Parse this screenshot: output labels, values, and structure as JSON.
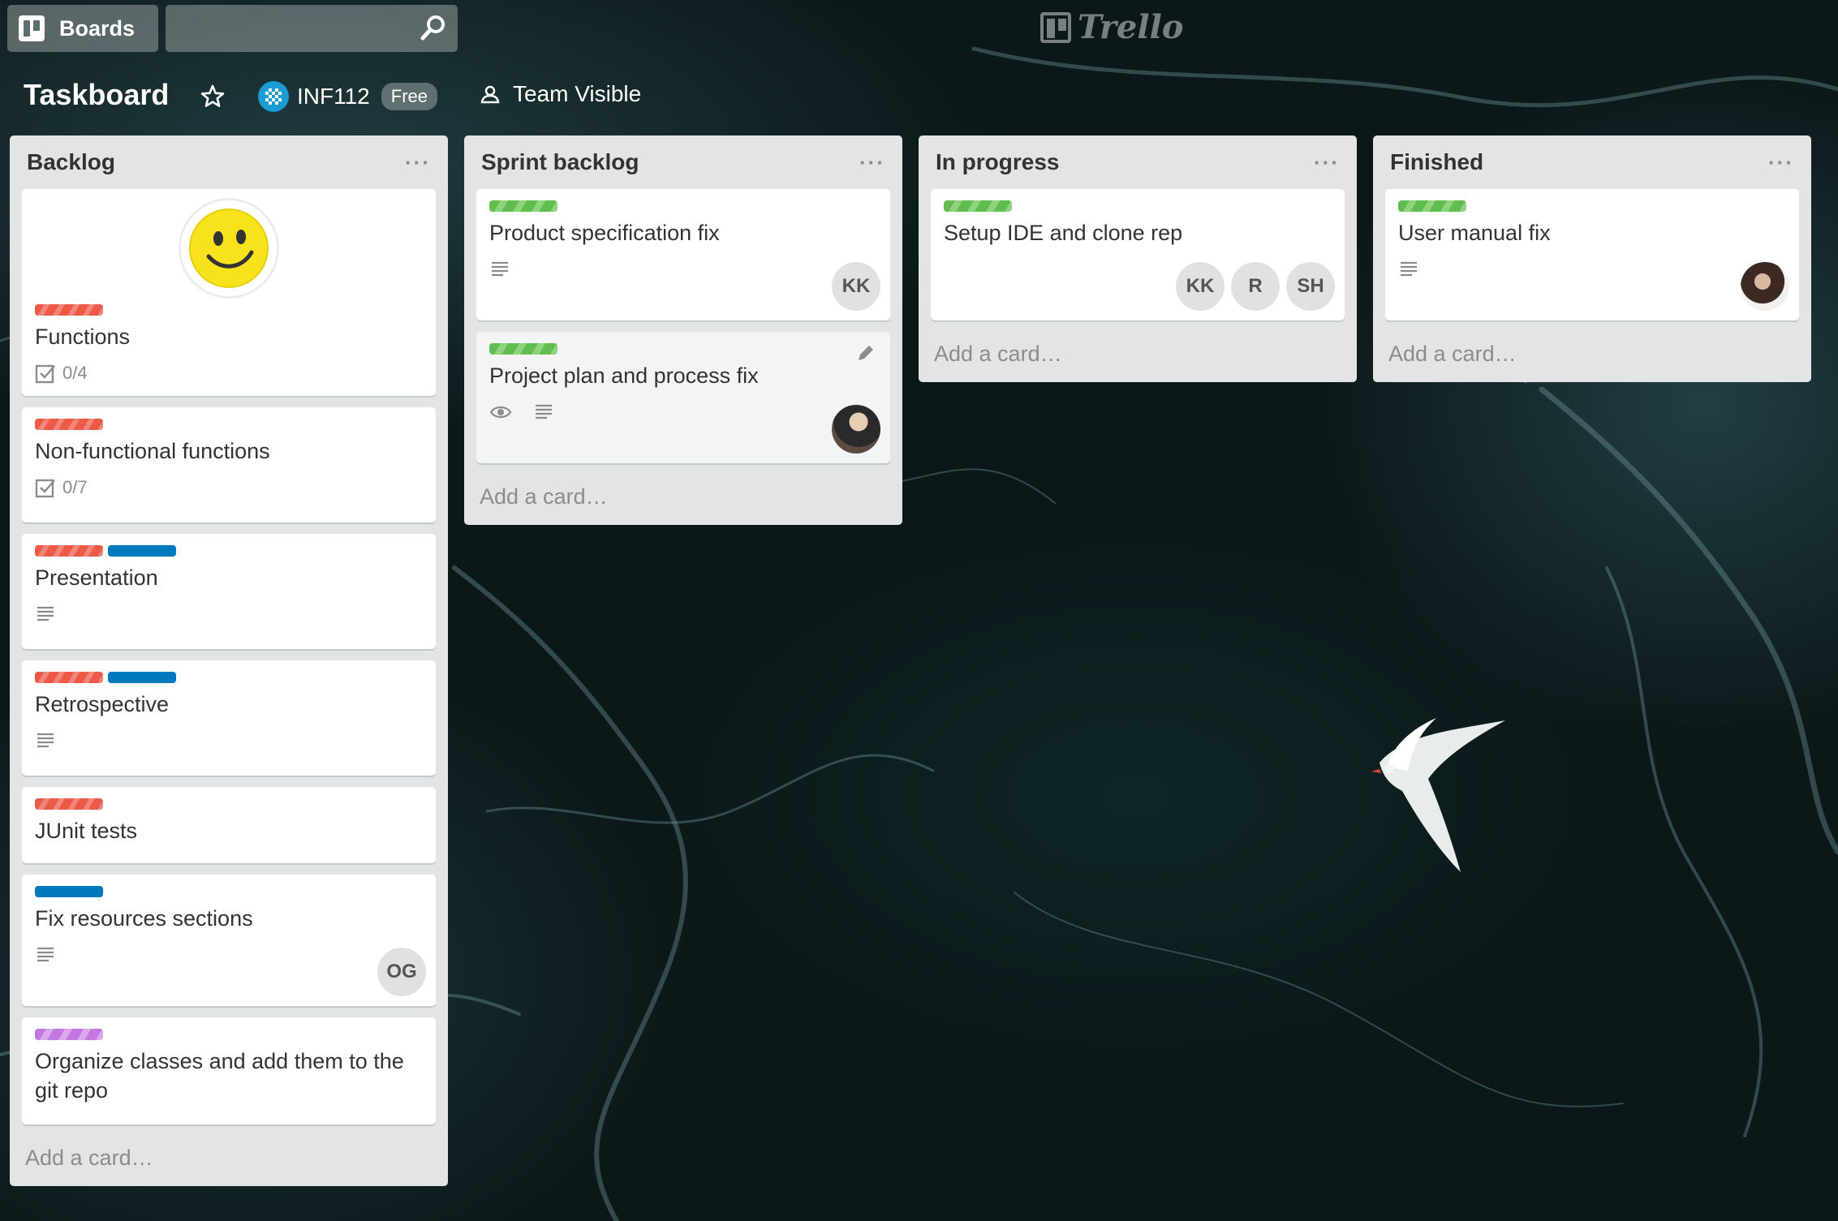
{
  "header": {
    "boards_label": "Boards",
    "search_value": "",
    "logo_text": "Trello"
  },
  "board": {
    "title": "Taskboard",
    "team_name": "INF112",
    "plan_badge": "Free",
    "visibility": "Team Visible"
  },
  "colors": {
    "label_red": "#eb5a46",
    "label_blue": "#0079bf",
    "label_green": "#61bd4f",
    "label_purple": "#c377e0",
    "list_bg": "#e2e4e6"
  },
  "lists": [
    {
      "title": "Backlog",
      "menu": "···",
      "add_card": "Add a card…",
      "cards": [
        {
          "title": "Functions",
          "labels": [
            "red"
          ],
          "checklist": "0/4",
          "cover": "smiley-icon"
        },
        {
          "title": "Non-functional functions",
          "labels": [
            "red"
          ],
          "checklist": "0/7"
        },
        {
          "title": "Presentation",
          "labels": [
            "red",
            "blue"
          ],
          "description": true
        },
        {
          "title": "Retrospective",
          "labels": [
            "red",
            "blue"
          ],
          "description": true
        },
        {
          "title": "JUnit tests",
          "labels": [
            "red"
          ]
        },
        {
          "title": "Fix resources sections",
          "labels": [
            "blue"
          ],
          "description": true,
          "members": [
            "OG"
          ]
        },
        {
          "title": "Organize classes and add them to the git repo",
          "labels": [
            "purple"
          ]
        }
      ]
    },
    {
      "title": "Sprint backlog",
      "menu": "···",
      "add_card": "Add a card…",
      "cards": [
        {
          "title": "Product specification fix",
          "labels": [
            "green"
          ],
          "description": true,
          "members": [
            "KK"
          ]
        },
        {
          "title": "Project plan and process fix",
          "labels": [
            "green"
          ],
          "watching": true,
          "description": true,
          "members": [
            "photo"
          ]
        }
      ]
    },
    {
      "title": "In progress",
      "menu": "···",
      "add_card": "Add a card…",
      "cards": [
        {
          "title": "Setup IDE and clone rep",
          "labels": [
            "green"
          ],
          "members": [
            "KK",
            "R",
            "SH"
          ]
        }
      ]
    },
    {
      "title": "Finished",
      "menu": "···",
      "add_card": "Add a card…",
      "cards": [
        {
          "title": "User manual fix",
          "labels": [
            "green"
          ],
          "description": true,
          "members": [
            "photo"
          ]
        }
      ]
    }
  ]
}
